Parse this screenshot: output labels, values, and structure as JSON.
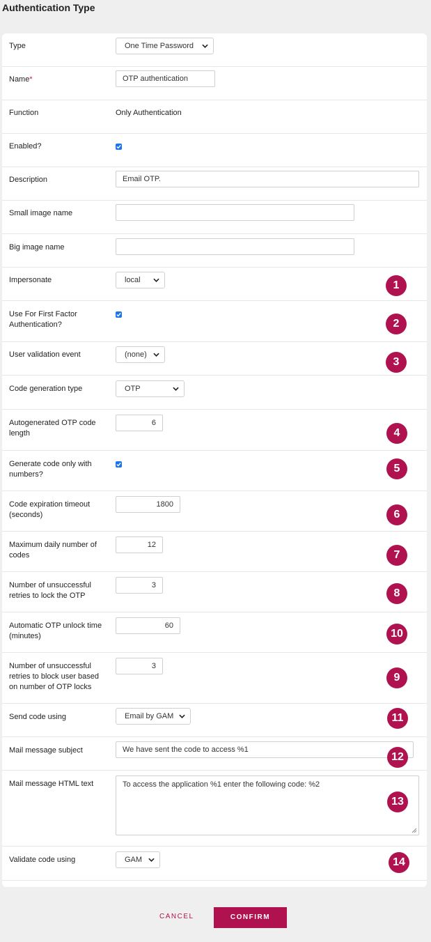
{
  "page": {
    "title": "Authentication Type"
  },
  "fields": {
    "type": {
      "label": "Type",
      "value": "One Time Password"
    },
    "name": {
      "label": "Name",
      "required_mark": "*",
      "value": "OTP authentication"
    },
    "function": {
      "label": "Function",
      "value": "Only Authentication"
    },
    "enabled": {
      "label": "Enabled?",
      "checked": true
    },
    "description": {
      "label": "Description",
      "value": "Email OTP."
    },
    "small_image": {
      "label": "Small image name",
      "value": ""
    },
    "big_image": {
      "label": "Big image name",
      "value": ""
    },
    "impersonate": {
      "label": "Impersonate",
      "value": "local"
    },
    "first_factor": {
      "label": "Use For First Factor Authentication?",
      "checked": true
    },
    "user_validation_event": {
      "label": "User validation event",
      "value": "(none)"
    },
    "code_generation_type": {
      "label": "Code generation type",
      "value": "OTP"
    },
    "otp_code_length": {
      "label": "Autogenerated OTP code length",
      "value": "6"
    },
    "numbers_only": {
      "label": "Generate code only with numbers?",
      "checked": true
    },
    "expiration_timeout": {
      "label": "Code expiration timeout (seconds)",
      "value": "1800"
    },
    "max_daily_codes": {
      "label": "Maximum daily number of codes",
      "value": "12"
    },
    "retries_lock_otp": {
      "label": "Number of unsuccessful retries to lock the OTP",
      "value": "3"
    },
    "unlock_time": {
      "label": "Automatic OTP unlock time (minutes)",
      "value": "60"
    },
    "retries_block_user": {
      "label": "Number of unsuccessful retries to block user based on number of OTP locks",
      "value": "3"
    },
    "send_code_using": {
      "label": "Send code using",
      "value": "Email by GAM"
    },
    "mail_subject": {
      "label": "Mail message subject",
      "value": "We have sent the code to access %1"
    },
    "mail_html": {
      "label": "Mail message HTML text",
      "value": "To access the application %1 enter the following code: %2"
    },
    "validate_code_using": {
      "label": "Validate code using",
      "value": "GAM"
    }
  },
  "badges": [
    "1",
    "2",
    "3",
    "4",
    "5",
    "6",
    "7",
    "8",
    "10",
    "9",
    "11",
    "12",
    "13",
    "14"
  ],
  "actions": {
    "cancel": "CANCEL",
    "confirm": "CONFIRM"
  },
  "colors": {
    "accent": "#b0124f",
    "checkbox": "#1a73e8",
    "background": "#efefef"
  }
}
